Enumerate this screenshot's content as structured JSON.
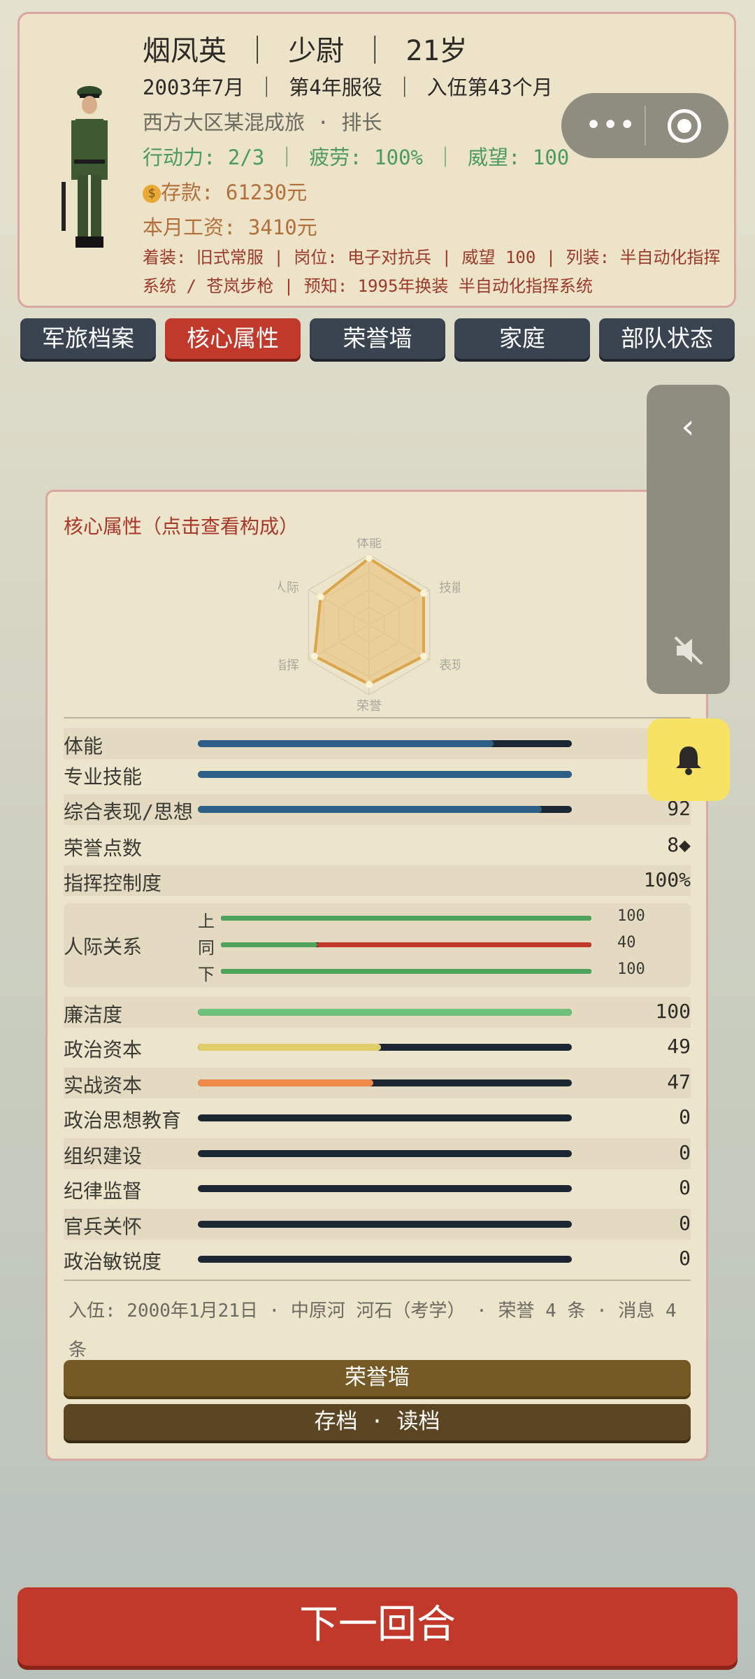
{
  "profile": {
    "name": "烟凤英",
    "rank": "少尉",
    "age": "21岁",
    "date": "2003年7月",
    "service_year": "第4年服役",
    "enlisted_months": "入伍第43个月",
    "unit": "西方大区某混成旅",
    "position": "排长",
    "action_points": "行动力: 2/3",
    "fatigue": "疲劳: 100%",
    "prestige": "威望: 100",
    "savings": "存款: 61230元",
    "salary": "本月工资: 3410元",
    "details": "着装: 旧式常服 | 岗位: 电子对抗兵 | 威望 100 | 列装: 半自动化指挥系统 / 苍岚步枪 | 预知: 1995年换装 半自动化指挥系统"
  },
  "capsule": {
    "more_icon": "more-dots-icon",
    "close_icon": "target-circle-icon"
  },
  "tabs": [
    {
      "label": "军旅档案"
    },
    {
      "label": "核心属性"
    },
    {
      "label": "荣誉墙"
    },
    {
      "label": "家庭"
    },
    {
      "label": "部队状态"
    }
  ],
  "core": {
    "title": "核心属性（点击查看构成）",
    "radar_labels": {
      "top": "体能",
      "top_right": "技能",
      "bottom_right": "表现",
      "bottom": "荣誉",
      "bottom_left": "指挥",
      "top_left": "人际"
    },
    "radar_values": [
      0.95,
      0.9,
      0.9,
      0.85,
      0.9,
      0.8
    ],
    "stats": [
      {
        "label": "体能",
        "value": "",
        "fill": 0.79,
        "color": "#2e5f86"
      },
      {
        "label": "专业技能",
        "value": "",
        "fill": 1.0,
        "color": "#2e5f86"
      },
      {
        "label": "综合表现/思想",
        "value": "92",
        "fill": 0.92,
        "color": "#2e5f86"
      },
      {
        "label": "荣誉点数",
        "value": "8◆"
      },
      {
        "label": "指挥控制度",
        "value": "100%"
      }
    ],
    "social": {
      "label": "人际关系",
      "rows": [
        {
          "tag": "上",
          "value": "100",
          "fill": 1.0,
          "color": "#4fa35a"
        },
        {
          "tag": "同",
          "value": "40",
          "fill": 0.4,
          "color": "#4fa35a",
          "neg_color": "#c0392b"
        },
        {
          "tag": "下",
          "value": "100",
          "fill": 1.0,
          "color": "#4fa35a"
        }
      ]
    },
    "stats2": [
      {
        "label": "廉洁度",
        "value": "100",
        "fill": 1.0,
        "color": "#6fc17a"
      },
      {
        "label": "政治资本",
        "value": "49",
        "fill": 0.49,
        "color": "#e0cc6a"
      },
      {
        "label": "实战资本",
        "value": "47",
        "fill": 0.47,
        "color": "#f08a4a"
      },
      {
        "label": "政治思想教育",
        "value": "0",
        "fill": 0,
        "color": "#2e5f86"
      },
      {
        "label": "组织建设",
        "value": "0",
        "fill": 0,
        "color": "#2e5f86"
      },
      {
        "label": "纪律监督",
        "value": "0",
        "fill": 0,
        "color": "#2e5f86"
      },
      {
        "label": "官兵关怀",
        "value": "0",
        "fill": 0,
        "color": "#2e5f86"
      },
      {
        "label": "政治敏锐度",
        "value": "0",
        "fill": 0,
        "color": "#2e5f86"
      }
    ],
    "footer": "入伍: 2000年1月21日 · 中原河 河石（考学） · 荣誉 4 条 · 消息 4 条",
    "honor_wall_button": "荣誉墙",
    "save_load_button": "存档 · 读档"
  },
  "side": {
    "back_icon": "chevron-left-icon",
    "mute_icon": "speaker-muted-icon",
    "bell_icon": "bell-icon"
  },
  "next_turn": "下一回合"
}
